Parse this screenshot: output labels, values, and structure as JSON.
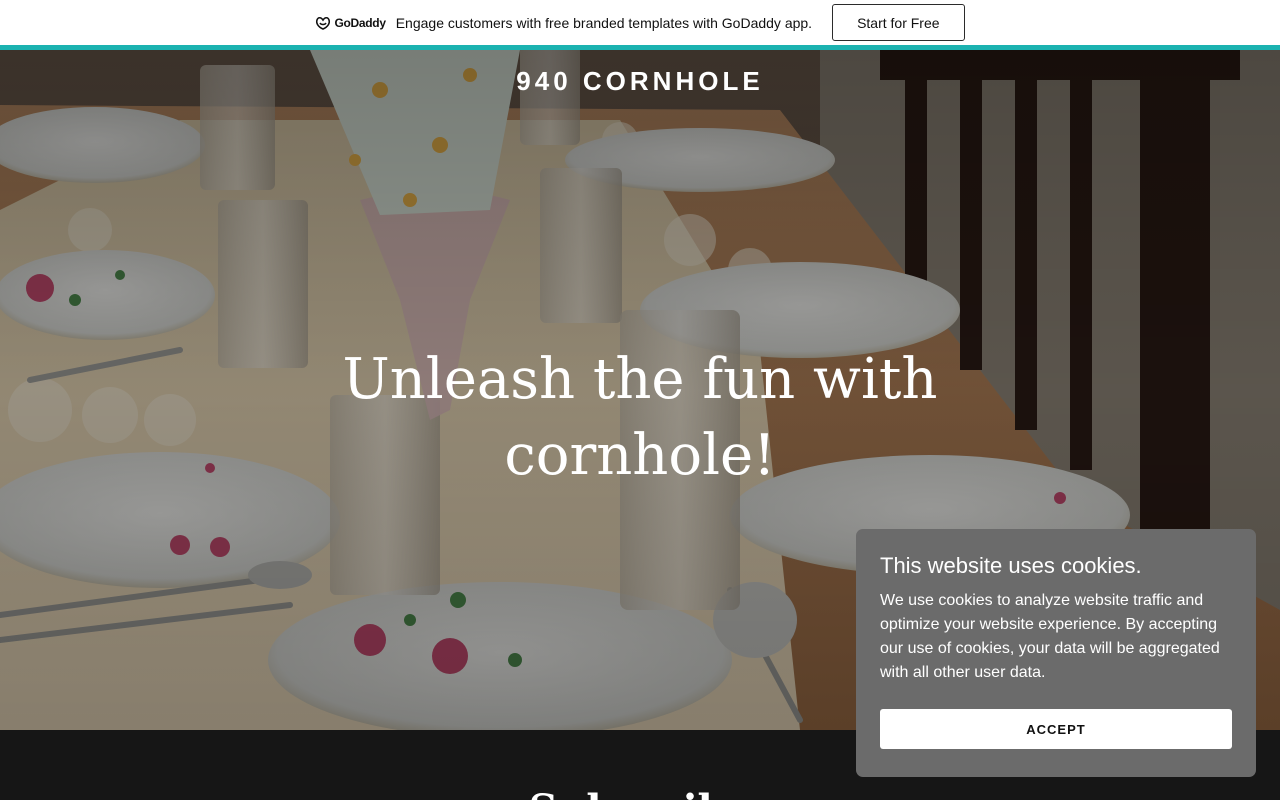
{
  "promo": {
    "logo_text": "GoDaddy",
    "message": "Engage customers with free branded templates with GoDaddy app.",
    "cta_label": "Start for Free",
    "accent_color": "#1bb2b0"
  },
  "hero": {
    "site_title": "940 CORNHOLE",
    "headline": "Unleash the fun with cornhole!"
  },
  "subscribe": {
    "heading": "Subscribe"
  },
  "cookie_banner": {
    "title": "This website uses cookies.",
    "body": "We use cookies to analyze website traffic and optimize your website experience. By accepting our use of cookies, your data will be aggregated with all other user data.",
    "accept_label": "ACCEPT"
  }
}
